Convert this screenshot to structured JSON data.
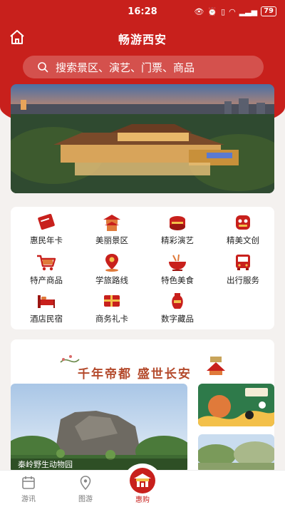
{
  "status": {
    "time": "16:28",
    "battery": "79"
  },
  "header": {
    "title": "畅游西安"
  },
  "search": {
    "placeholder": "搜索景区、演艺、门票、商品"
  },
  "grid": {
    "items": [
      {
        "label": "惠民年卡",
        "icon": "card-icon"
      },
      {
        "label": "美丽景区",
        "icon": "pagoda-icon"
      },
      {
        "label": "精彩演艺",
        "icon": "drum-icon"
      },
      {
        "label": "精美文创",
        "icon": "lion-head-icon"
      },
      {
        "label": "特产商品",
        "icon": "cart-icon"
      },
      {
        "label": "学旅路线",
        "icon": "route-pin-icon"
      },
      {
        "label": "特色美食",
        "icon": "bowl-icon"
      },
      {
        "label": "出行服务",
        "icon": "bus-icon"
      },
      {
        "label": "酒店民宿",
        "icon": "bed-icon"
      },
      {
        "label": "商务礼卡",
        "icon": "gift-card-icon"
      },
      {
        "label": "数字藏品",
        "icon": "vase-icon"
      }
    ]
  },
  "promo": {
    "slogan": "千年帝都 盛世长安",
    "main_caption": "秦岭野生动物园"
  },
  "tabbar": {
    "tabs": [
      {
        "label": "游讯",
        "icon": "news-icon"
      },
      {
        "label": "图游",
        "icon": "map-pin-icon"
      },
      {
        "label": "惠购",
        "icon": "palace-gate-icon"
      }
    ]
  },
  "colors": {
    "brand": "#c8201c",
    "background": "#f4f1ef"
  }
}
